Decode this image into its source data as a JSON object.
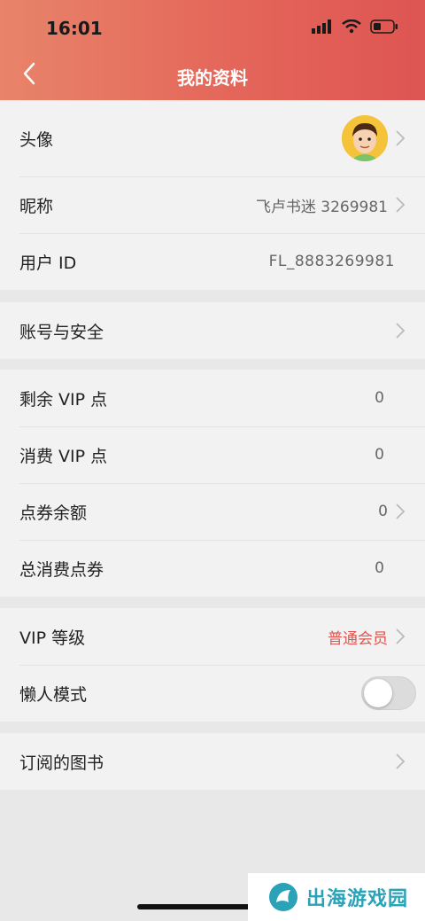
{
  "status_bar": {
    "time": "16:01"
  },
  "nav": {
    "title": "我的资料"
  },
  "profile": {
    "avatar_label": "头像",
    "nickname_label": "昵称",
    "nickname_value": "飞卢书迷 3269981",
    "userid_label": "用户 ID",
    "userid_value": "FL_8883269981"
  },
  "account": {
    "security_label": "账号与安全"
  },
  "points": {
    "remaining_vip_label": "剩余 VIP 点",
    "remaining_vip_value": "0",
    "consumed_vip_label": "消费 VIP 点",
    "consumed_vip_value": "0",
    "voucher_balance_label": "点券余额",
    "voucher_balance_value": "0",
    "total_voucher_label": "总消费点券",
    "total_voucher_value": "0"
  },
  "vip": {
    "level_label": "VIP 等级",
    "level_value": "普通会员",
    "lazy_mode_label": "懒人模式",
    "lazy_mode_on": false
  },
  "books": {
    "subscribed_label": "订阅的图书"
  },
  "watermark": {
    "text": "出海游戏园"
  },
  "colors": {
    "header_start": "#e8846a",
    "header_end": "#de5552",
    "accent_red": "#e0554f",
    "watermark": "#2aa3b8"
  }
}
